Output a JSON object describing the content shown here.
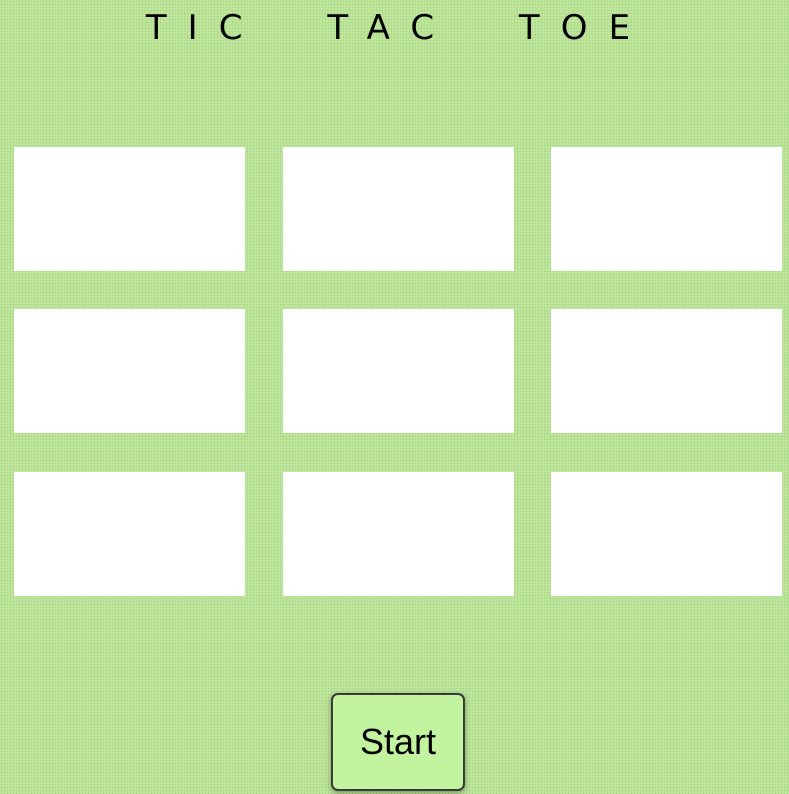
{
  "header": {
    "title": "TIC  TAC  TOE"
  },
  "board": {
    "rows": [
      [
        "",
        "",
        ""
      ],
      [
        "",
        "",
        ""
      ],
      [
        "",
        "",
        ""
      ]
    ]
  },
  "controls": {
    "start_label": "Start"
  },
  "colors": {
    "background": "#bde69a",
    "cell": "#ffffff",
    "button": "#c2f4a0"
  }
}
